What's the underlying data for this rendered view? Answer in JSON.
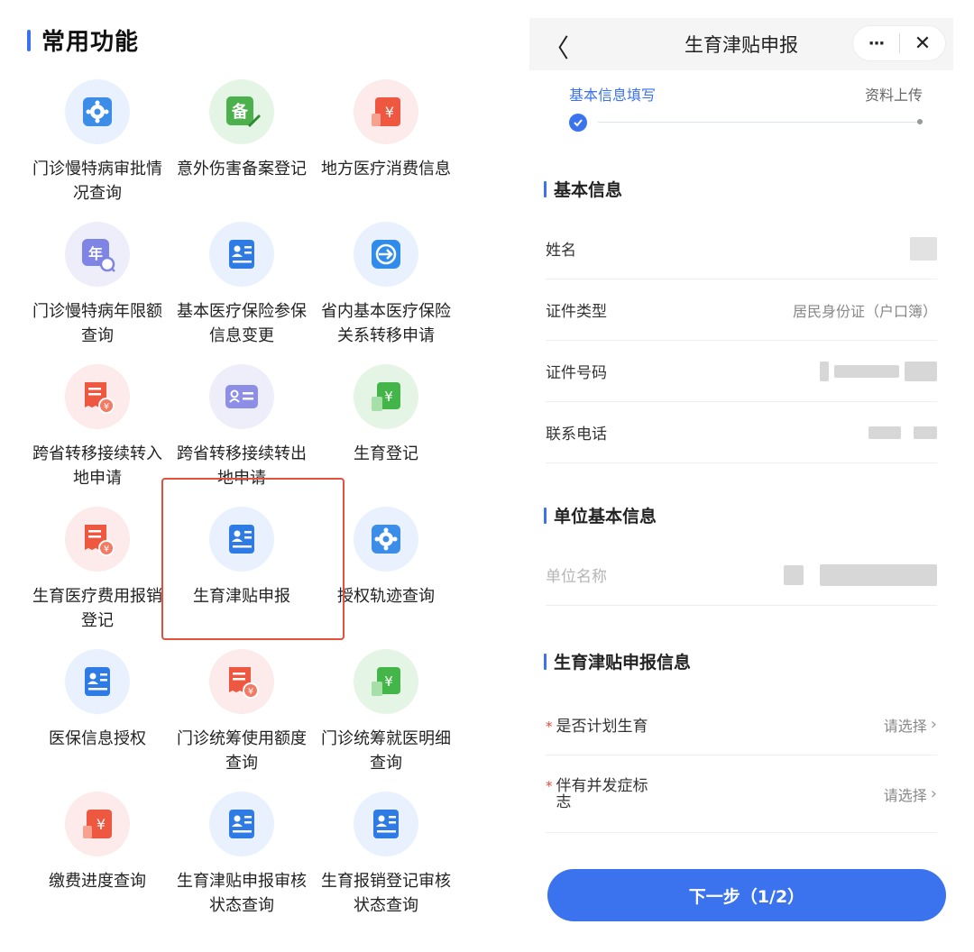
{
  "section_title": "常用功能",
  "functions": [
    {
      "label": "门诊慢特病审批情况查询",
      "icon": "gear-icon",
      "bg": "blue"
    },
    {
      "label": "意外伤害备案登记",
      "icon": "bei-edit-icon",
      "bg": "green"
    },
    {
      "label": "地方医疗消费信息",
      "icon": "yuan-card-icon",
      "bg": "red"
    },
    {
      "label": "门诊慢特病年限额查询",
      "icon": "year-search-icon",
      "bg": "purple"
    },
    {
      "label": "基本医疗保险参保信息变更",
      "icon": "person-card-icon",
      "bg": "blue"
    },
    {
      "label": "省内基本医疗保险关系转移申请",
      "icon": "transfer-icon",
      "bg": "blue"
    },
    {
      "label": "跨省转移接续转入地申请",
      "icon": "receipt-yuan-icon",
      "bg": "red"
    },
    {
      "label": "跨省转移接续转出地申请",
      "icon": "id-card-icon",
      "bg": "purple"
    },
    {
      "label": "生育登记",
      "icon": "yuan-book-icon",
      "bg": "green"
    },
    {
      "label": "生育医疗费用报销登记",
      "icon": "receipt-yuan-icon",
      "bg": "red"
    },
    {
      "label": "生育津贴申报",
      "icon": "person-card-icon",
      "bg": "blue"
    },
    {
      "label": "授权轨迹查询",
      "icon": "gear-icon",
      "bg": "blue"
    },
    {
      "label": "医保信息授权",
      "icon": "person-card-icon",
      "bg": "blue"
    },
    {
      "label": "门诊统筹使用额度查询",
      "icon": "receipt-yuan-icon",
      "bg": "red"
    },
    {
      "label": "门诊统筹就医明细查询",
      "icon": "yuan-book-icon",
      "bg": "green"
    },
    {
      "label": "缴费进度查询",
      "icon": "yuan-card-icon",
      "bg": "red"
    },
    {
      "label": "生育津贴申报审核状态查询",
      "icon": "person-card-icon",
      "bg": "blue"
    },
    {
      "label": "生育报销登记审核状态查询",
      "icon": "person-card-icon",
      "bg": "blue"
    }
  ],
  "phone": {
    "back": "〈",
    "title": "生育津贴申报",
    "more": "···",
    "close": "✕",
    "steps": [
      "基本信息填写",
      "资料上传"
    ],
    "basic_group": "基本信息",
    "name_label": "姓名",
    "idtype_label": "证件类型",
    "idtype_value": "居民身份证（户口簿）",
    "idno_label": "证件号码",
    "phone_label": "联系电话",
    "unit_group": "单位基本信息",
    "unit_name_label": "单位名称",
    "benefit_group": "生育津贴申报信息",
    "plan_label": "是否计划生育",
    "plan_value": "请选择",
    "comp_label": "伴有并发症标志",
    "comp_value": "请选择",
    "next_button": "下一步（1/2）"
  },
  "colors": {
    "accent": "#3b72ee",
    "highlight": "#e0513e",
    "required": "#e24b3c"
  }
}
